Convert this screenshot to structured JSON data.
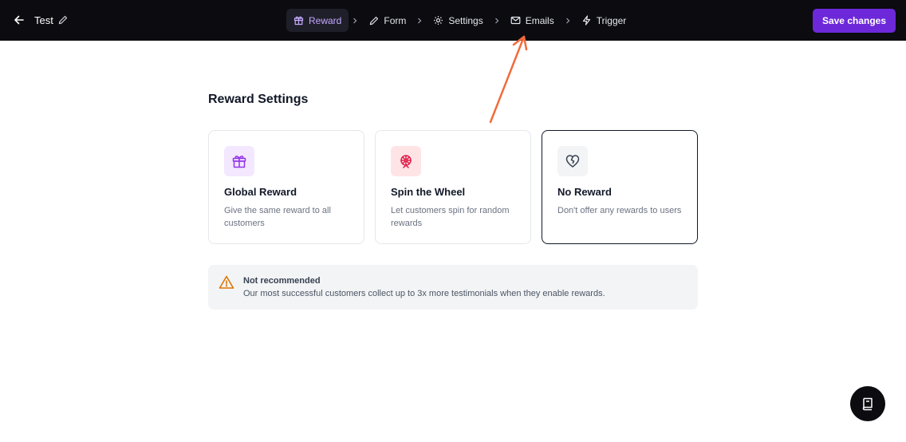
{
  "header": {
    "project_title": "Test",
    "save_label": "Save changes",
    "colors": {
      "background": "#0b0b10",
      "accent": "#6d28d9",
      "active_step_text": "#c4a9ff"
    }
  },
  "steps": [
    {
      "label": "Reward",
      "icon": "gift-icon",
      "active": true
    },
    {
      "label": "Form",
      "icon": "pencil-icon",
      "active": false
    },
    {
      "label": "Settings",
      "icon": "gear-icon",
      "active": false
    },
    {
      "label": "Emails",
      "icon": "mail-icon",
      "active": false
    },
    {
      "label": "Trigger",
      "icon": "lightning-icon",
      "active": false
    }
  ],
  "main": {
    "title": "Reward Settings",
    "cards": [
      {
        "title": "Global Reward",
        "description": "Give the same reward to all customers",
        "icon": "gift-icon",
        "icon_bg": "#f3e8ff",
        "icon_color": "#9333ea",
        "selected": false
      },
      {
        "title": "Spin the Wheel",
        "description": "Let customers spin for random rewards",
        "icon": "ferris-wheel-icon",
        "icon_bg": "#ffe4e6",
        "icon_color": "#e11d48",
        "selected": false
      },
      {
        "title": "No Reward",
        "description": "Don't offer any rewards to users",
        "icon": "heart-crack-icon",
        "icon_bg": "#f3f4f6",
        "icon_color": "#374151",
        "selected": true
      }
    ],
    "warning": {
      "title": "Not recommended",
      "text": "Our most successful customers collect up to 3x more testimonials when they enable rewards.",
      "icon": "warning-triangle-icon",
      "color": "#d97706"
    }
  },
  "help_button": {
    "icon": "book-icon"
  },
  "annotation": {
    "icon": "arrow-icon",
    "color": "#f26b3a"
  }
}
